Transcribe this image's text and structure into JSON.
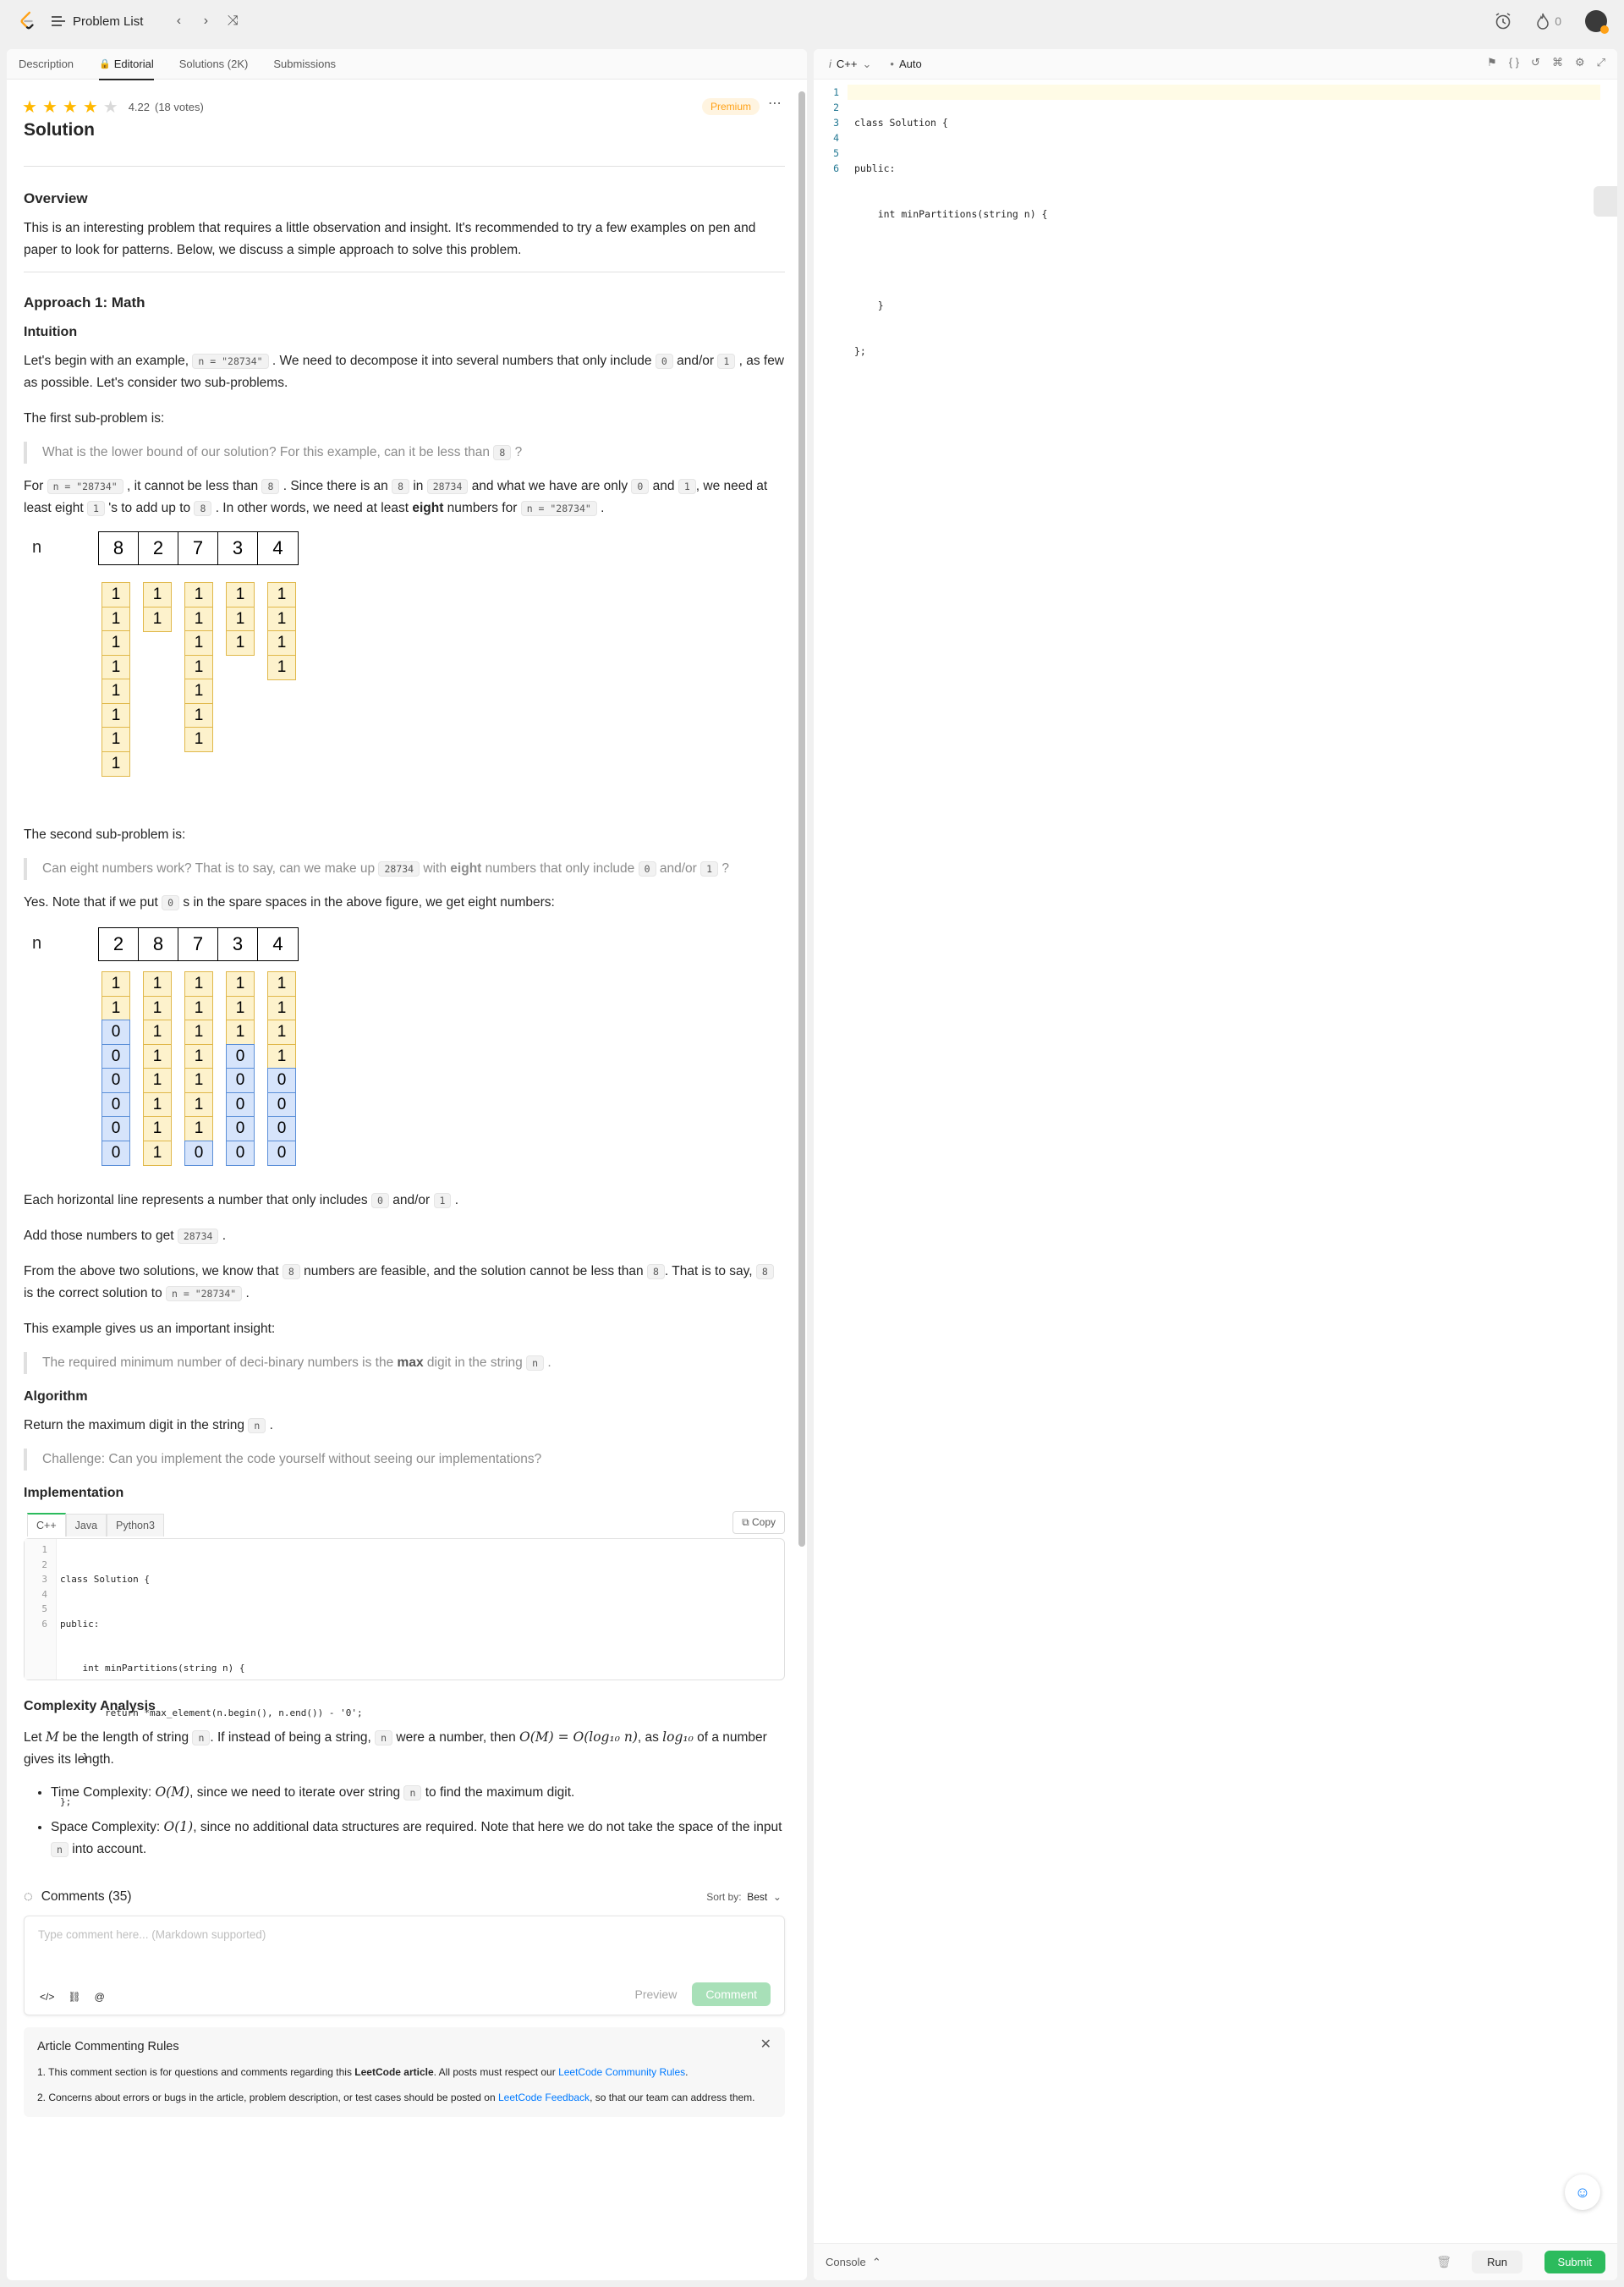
{
  "topbar": {
    "problem_list": "Problem List",
    "streak": "0"
  },
  "tabs": [
    {
      "label": "Description"
    },
    {
      "label": "Editorial"
    },
    {
      "label": "Solutions (2K)"
    },
    {
      "label": "Submissions"
    }
  ],
  "article": {
    "rating": "4.22",
    "votes": "(18 votes)",
    "premium": "Premium",
    "title": "Solution",
    "overview_h": "Overview",
    "overview_p": "This is an interesting problem that requires a little observation and insight. It's recommended to try a few examples on pen and paper to look for patterns. Below, we discuss a simple approach to solve this problem.",
    "approach_h": "Approach 1: Math",
    "intuition_h": "Intuition",
    "p1_a": "Let's begin with an example,",
    "code_n": "n = \"28734\"",
    "p1_b": ". We need to decompose it into several numbers that only include",
    "code_0": "0",
    "p1_c": "and/or",
    "code_1": "1",
    "p1_d": ", as few as possible. Let's consider two sub-problems.",
    "first_sub": "The first sub-problem is:",
    "q1_a": "What is the lower bound of our solution? For this example, can it be less than",
    "code_8": "8",
    "q1_b": "?",
    "p2_a": "For",
    "p2_b": ", it cannot be less than",
    "p2_c": ". Since there is an",
    "p2_d": "in",
    "code_28734": "28734",
    "p2_e": "and what we have are only",
    "p2_f": "and",
    "p2_g": ", we need at least eight",
    "p2_h": "'s to add up to",
    "p2_i": ". In other words, we need at least",
    "p2_eight": "eight",
    "p2_j": "numbers for",
    "p2_k": ".",
    "fig_n": "n",
    "fig1_digits": [
      "8",
      "2",
      "7",
      "3",
      "4"
    ],
    "fig2_digits": [
      "2",
      "8",
      "7",
      "3",
      "4"
    ],
    "cell_one": "1",
    "cell_zero": "0",
    "second_sub": "The second sub-problem is:",
    "q2_a": "Can eight numbers work? That is to say, can we make up",
    "q2_b": "with",
    "q2_eight": "eight",
    "q2_c": "numbers that only include",
    "q2_d": "and/or",
    "q2_e": "?",
    "p3_a": "Yes. Note that if we put",
    "p3_b": "s in the spare spaces in the above figure, we get eight numbers:",
    "p4_a": "Each horizontal line represents a number that only includes",
    "p4_b": "and/or",
    "p4_c": ".",
    "p5_a": "Add those numbers to get",
    "p5_b": ".",
    "p6_a": "From the above two solutions, we know that",
    "p6_b": "numbers are feasible, and the solution cannot be less than",
    "p6_c": ". That is to say,",
    "p6_d": "is the correct solution to",
    "p6_e": ".",
    "p7": "This example gives us an important insight:",
    "q3_a": "The required minimum number of deci-binary numbers is the",
    "q3_max": "max",
    "q3_b": "digit in the string",
    "code_nvar": "n",
    "q3_c": ".",
    "algorithm_h": "Algorithm",
    "p8_a": "Return the maximum digit in the string",
    "p8_b": ".",
    "q4": "Challenge: Can you implement the code yourself without seeing our implementations?",
    "impl_h": "Implementation",
    "impl_tabs": [
      "C++",
      "Java",
      "Python3"
    ],
    "copy": "Copy",
    "impl_code": [
      {
        "n": "1",
        "t": "class Solution {"
      },
      {
        "n": "2",
        "t": "public:"
      },
      {
        "n": "3",
        "t": "    int minPartitions(string n) {"
      },
      {
        "n": "4",
        "t": "        return *max_element(n.begin(), n.end()) - '0';"
      },
      {
        "n": "5",
        "t": "    }"
      },
      {
        "n": "6",
        "t": "};"
      }
    ],
    "cx_h": "Complexity Analysis",
    "cx_a": "Let",
    "cx_M": "M",
    "cx_b": "be the length of string",
    "cx_c": ". If instead of being a string,",
    "cx_d": "were a number, then",
    "cx_eq": "O(M) = O(log₁₀ n)",
    "cx_e": ", as",
    "cx_log": "log₁₀",
    "cx_f": "of a number gives its length.",
    "time_a": "Time Complexity:",
    "time_o": "O(M)",
    "time_b": ", since we need to iterate over string",
    "time_c": "to find the maximum digit.",
    "space_a": "Space Complexity:",
    "space_o": "O(1)",
    "space_b": ", since no additional data structures are required. Note that here we do not take the space of the input",
    "space_c": "into account.",
    "comments": "Comments (35)",
    "sort_by": "Sort by:",
    "sort_val": "Best",
    "comment_placeholder": "Type comment here... (Markdown supported)",
    "preview": "Preview",
    "comment_btn": "Comment",
    "rules_title": "Article Commenting Rules",
    "rule1_a": "1. This comment section is for questions and comments regarding this",
    "rule1_b": "LeetCode article",
    "rule1_c": ". All posts must respect our",
    "rule1_link": "LeetCode Community Rules",
    "rule1_d": ".",
    "rule2_a": "2. Concerns about errors or bugs in the article, problem description, or test cases should be posted on",
    "rule2_link": "LeetCode Feedback",
    "rule2_b": ", so that our team can address them."
  },
  "editor": {
    "lang": "C++",
    "mode": "Auto",
    "lines": [
      {
        "n": "1",
        "t": "class Solution {"
      },
      {
        "n": "2",
        "t": "public:"
      },
      {
        "n": "3",
        "t": "    int minPartitions(string n) {"
      },
      {
        "n": "4",
        "t": ""
      },
      {
        "n": "5",
        "t": "    }"
      },
      {
        "n": "6",
        "t": "};"
      }
    ],
    "console": "Console",
    "run": "Run",
    "submit": "Submit"
  }
}
